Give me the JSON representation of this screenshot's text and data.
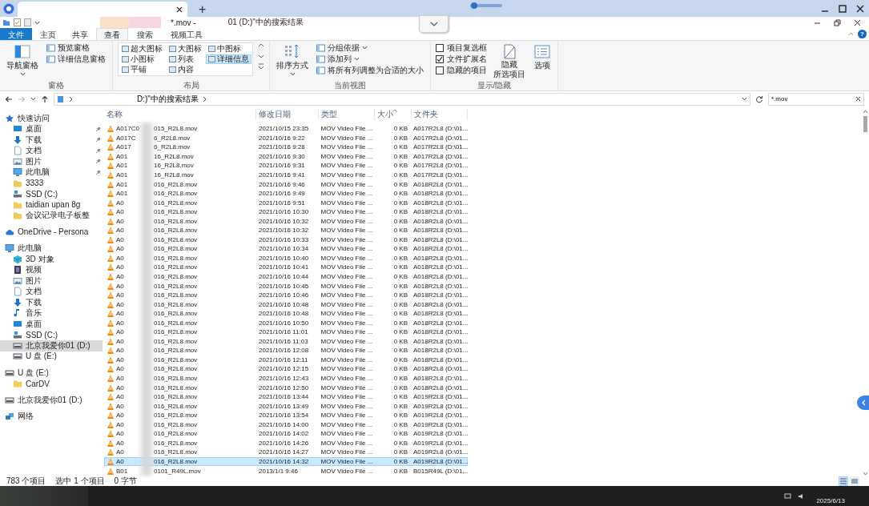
{
  "browser": {
    "new_tab": "+"
  },
  "window": {
    "title_start": "*.mov - ",
    "title_end": "01 (D:)\"中的搜索结果"
  },
  "ribbon": {
    "help": "?",
    "tabs": [
      {
        "label": "文件",
        "kind": "file",
        "selected": false
      },
      {
        "label": "主页",
        "kind": "normal",
        "selected": false
      },
      {
        "label": "共享",
        "kind": "normal",
        "selected": false
      },
      {
        "label": "查看",
        "kind": "normal",
        "selected": true
      },
      {
        "label": "搜索",
        "kind": "search",
        "selected": false
      },
      {
        "label": "视频工具",
        "kind": "video",
        "selected": false
      }
    ],
    "groups": [
      {
        "label": "窗格",
        "items": [
          {
            "kind": "large",
            "label": "导航窗格",
            "dropdown": true
          },
          {
            "kind": "small",
            "label": "预览窗格",
            "dropdown": false
          },
          {
            "kind": "small",
            "label": "详细信息窗格",
            "dropdown": false
          }
        ]
      },
      {
        "label": "布局",
        "items": [
          {
            "kind": "view",
            "label": "超大图标",
            "selected": false
          },
          {
            "kind": "view",
            "label": "大图标",
            "selected": false
          },
          {
            "kind": "view",
            "label": "中图标",
            "selected": false
          },
          {
            "kind": "view",
            "label": "小图标",
            "selected": false
          },
          {
            "kind": "view",
            "label": "列表",
            "selected": false
          },
          {
            "kind": "view",
            "label": "详细信息",
            "selected": true
          },
          {
            "kind": "view",
            "label": "平铺",
            "selected": false
          },
          {
            "kind": "view",
            "label": "内容",
            "selected": false
          }
        ]
      },
      {
        "label": "当前视图",
        "items": [
          {
            "kind": "large",
            "label": "排序方式",
            "dropdown": true
          },
          {
            "kind": "small",
            "label": "分组依据",
            "dropdown": true
          },
          {
            "kind": "small",
            "label": "添加列",
            "dropdown": true
          },
          {
            "kind": "small",
            "label": "将所有列调整为合适的大小",
            "dropdown": false
          }
        ]
      },
      {
        "label": "显示/隐藏",
        "items": [
          {
            "kind": "check",
            "label": "项目复选框",
            "checked": false
          },
          {
            "kind": "check",
            "label": "文件扩展名",
            "checked": true
          },
          {
            "kind": "check",
            "label": "隐藏的项目",
            "checked": false
          },
          {
            "kind": "large2",
            "lines": [
              "隐藏",
              "所选项目"
            ]
          },
          {
            "kind": "large",
            "label": "选项",
            "dropdown": false
          }
        ]
      }
    ]
  },
  "address": {
    "path_end": "D:)\"中的搜索结果",
    "search_value": "*.mov"
  },
  "nav": [
    {
      "label": "快速访问",
      "kind": "star",
      "selected": false,
      "children": [
        {
          "label": "桌面",
          "kind": "desktop",
          "selected": false,
          "pinned": true
        },
        {
          "label": "下载",
          "kind": "download",
          "selected": false,
          "pinned": true
        },
        {
          "label": "文档",
          "kind": "document",
          "selected": false,
          "pinned": true
        },
        {
          "label": "图片",
          "kind": "picture",
          "selected": false,
          "pinned": true
        },
        {
          "label": "此电脑",
          "kind": "computer",
          "selected": false,
          "pinned": true
        },
        {
          "label": "3333",
          "kind": "folder",
          "selected": false,
          "pinned": false
        },
        {
          "label": "SSD (C:)",
          "kind": "sysdrive",
          "selected": false,
          "pinned": false
        },
        {
          "label": "taidian upan 8g",
          "kind": "folder",
          "selected": false,
          "pinned": false
        },
        {
          "label": "会议记录电子板整",
          "kind": "folder",
          "selected": false,
          "pinned": false
        }
      ]
    },
    {
      "label": "OneDrive - Persona",
      "kind": "cloud",
      "selected": false
    },
    {
      "label": "此电脑",
      "kind": "computer",
      "selected": false,
      "children": [
        {
          "label": "3D 对象",
          "kind": "cube",
          "selected": false
        },
        {
          "label": "视频",
          "kind": "video",
          "selected": false
        },
        {
          "label": "图片",
          "kind": "picture",
          "selected": false
        },
        {
          "label": "文档",
          "kind": "document",
          "selected": false
        },
        {
          "label": "下载",
          "kind": "download",
          "selected": false
        },
        {
          "label": "音乐",
          "kind": "music",
          "selected": false
        },
        {
          "label": "桌面",
          "kind": "desktop",
          "selected": false
        },
        {
          "label": "SSD (C:)",
          "kind": "sysdrive",
          "selected": false
        },
        {
          "label": "北京我爱你01 (D:)",
          "kind": "drive",
          "selected": true
        },
        {
          "label": "U 盘 (E:)",
          "kind": "drive",
          "selected": false
        }
      ]
    },
    {
      "label": "U 盘 (E:)",
      "kind": "drive",
      "selected": false,
      "children": [
        {
          "label": "CarDV",
          "kind": "folder",
          "selected": false
        }
      ]
    },
    {
      "label": "北京我爱你01 (D:)",
      "kind": "drive",
      "selected": false
    },
    {
      "label": "网络",
      "kind": "network",
      "selected": false
    }
  ],
  "files": {
    "columns": [
      {
        "label": "名称",
        "sorted": false
      },
      {
        "label": "修改日期",
        "sorted": false
      },
      {
        "label": "类型",
        "sorted": false
      },
      {
        "label": "大小",
        "sorted": true
      },
      {
        "label": "文件夹",
        "sorted": false
      }
    ],
    "rows": [
      {
        "name_start": "A017C0",
        "name_end": "015_R2L8.mov",
        "modified": "2021/10/15 23:35",
        "type": "MOV Video File ...",
        "size": "0 KB",
        "folder": "A017R2L8 (D:\\01...",
        "selected": false
      },
      {
        "name_start": "A017C",
        "name_end": "6_R2L8.mov",
        "modified": "2021/10/16 9:22",
        "type": "MOV Video File ...",
        "size": "0 KB",
        "folder": "A017R2L8 (D:\\01...",
        "selected": false
      },
      {
        "name_start": "A017",
        "name_end": "6_R2L8.mov",
        "modified": "2021/10/16 9:28",
        "type": "MOV Video File ...",
        "size": "0 KB",
        "folder": "A017R2L8 (D:\\01...",
        "selected": false
      },
      {
        "name_start": "A01",
        "name_end": "16_R2L8.mov",
        "modified": "2021/10/16 9:30",
        "type": "MOV Video File ...",
        "size": "0 KB",
        "folder": "A017R2L8 (D:\\01...",
        "selected": false
      },
      {
        "name_start": "A01",
        "name_end": "16_R2L8.mov",
        "modified": "2021/10/16 9:31",
        "type": "MOV Video File ...",
        "size": "0 KB",
        "folder": "A017R2L8 (D:\\01...",
        "selected": false
      },
      {
        "name_start": "A01",
        "name_end": "16_R2L8.mov",
        "modified": "2021/10/16 9:41",
        "type": "MOV Video File ...",
        "size": "0 KB",
        "folder": "A017R2L8 (D:\\01...",
        "selected": false
      },
      {
        "name_start": "A01",
        "name_end": "016_R2L8.mov",
        "modified": "2021/10/16 9:46",
        "type": "MOV Video File ...",
        "size": "0 KB",
        "folder": "A018R2L8 (D:\\01...",
        "selected": false
      },
      {
        "name_start": "A01",
        "name_end": "016_R2L8.mov",
        "modified": "2021/10/16 9:49",
        "type": "MOV Video File ...",
        "size": "0 KB",
        "folder": "A018R2L8 (D:\\01...",
        "selected": false
      },
      {
        "name_start": "A0",
        "name_end": "016_R2L8.mov",
        "modified": "2021/10/16 9:51",
        "type": "MOV Video File ...",
        "size": "0 KB",
        "folder": "A018R2L8 (D:\\01...",
        "selected": false
      },
      {
        "name_start": "A0",
        "name_end": "016_R2L8.mov",
        "modified": "2021/10/16 10:30",
        "type": "MOV Video File ...",
        "size": "0 KB",
        "folder": "A018R2L8 (D:\\01...",
        "selected": false
      },
      {
        "name_start": "A0",
        "name_end": "016_R2L8.mov",
        "modified": "2021/10/16 10:32",
        "type": "MOV Video File ...",
        "size": "0 KB",
        "folder": "A018R2L8 (D:\\01...",
        "selected": false
      },
      {
        "name_start": "A0",
        "name_end": "016_R2L8.mov",
        "modified": "2021/10/16 10:32",
        "type": "MOV Video File ...",
        "size": "0 KB",
        "folder": "A018R2L8 (D:\\01...",
        "selected": false
      },
      {
        "name_start": "A0",
        "name_end": "016_R2L8.mov",
        "modified": "2021/10/16 10:33",
        "type": "MOV Video File ...",
        "size": "0 KB",
        "folder": "A018R2L8 (D:\\01...",
        "selected": false
      },
      {
        "name_start": "A0",
        "name_end": "016_R2L8.mov",
        "modified": "2021/10/16 10:34",
        "type": "MOV Video File ...",
        "size": "0 KB",
        "folder": "A018R2L8 (D:\\01...",
        "selected": false
      },
      {
        "name_start": "A0",
        "name_end": "016_R2L8.mov",
        "modified": "2021/10/16 10:40",
        "type": "MOV Video File ...",
        "size": "0 KB",
        "folder": "A018R2L8 (D:\\01...",
        "selected": false
      },
      {
        "name_start": "A0",
        "name_end": "016_R2L8.mov",
        "modified": "2021/10/16 10:41",
        "type": "MOV Video File ...",
        "size": "0 KB",
        "folder": "A018R2L8 (D:\\01...",
        "selected": false
      },
      {
        "name_start": "A0",
        "name_end": "016_R2L8.mov",
        "modified": "2021/10/16 10:44",
        "type": "MOV Video File ...",
        "size": "0 KB",
        "folder": "A018R2L8 (D:\\01...",
        "selected": false
      },
      {
        "name_start": "A0",
        "name_end": "016_R2L8.mov",
        "modified": "2021/10/16 10:45",
        "type": "MOV Video File ...",
        "size": "0 KB",
        "folder": "A018R2L8 (D:\\01...",
        "selected": false
      },
      {
        "name_start": "A0",
        "name_end": "016_R2L8.mov",
        "modified": "2021/10/16 10:46",
        "type": "MOV Video File ...",
        "size": "0 KB",
        "folder": "A018R2L8 (D:\\01...",
        "selected": false
      },
      {
        "name_start": "A0",
        "name_end": "016_R2L8.mov",
        "modified": "2021/10/16 10:48",
        "type": "MOV Video File ...",
        "size": "0 KB",
        "folder": "A018R2L8 (D:\\01...",
        "selected": false
      },
      {
        "name_start": "A0",
        "name_end": "016_R2L8.mov",
        "modified": "2021/10/16 10:48",
        "type": "MOV Video File ...",
        "size": "0 KB",
        "folder": "A018R2L8 (D:\\01...",
        "selected": false
      },
      {
        "name_start": "A0",
        "name_end": "016_R2L8.mov",
        "modified": "2021/10/16 10:50",
        "type": "MOV Video File ...",
        "size": "0 KB",
        "folder": "A018R2L8 (D:\\01...",
        "selected": false
      },
      {
        "name_start": "A0",
        "name_end": "016_R2L8.mov",
        "modified": "2021/10/16 11:01",
        "type": "MOV Video File ...",
        "size": "0 KB",
        "folder": "A018R2L8 (D:\\01...",
        "selected": false
      },
      {
        "name_start": "A0",
        "name_end": "016_R2L8.mov",
        "modified": "2021/10/16 11:03",
        "type": "MOV Video File ...",
        "size": "0 KB",
        "folder": "A018R2L8 (D:\\01...",
        "selected": false
      },
      {
        "name_start": "A0",
        "name_end": "016_R2L8.mov",
        "modified": "2021/10/16 12:08",
        "type": "MOV Video File ...",
        "size": "0 KB",
        "folder": "A018R2L8 (D:\\01...",
        "selected": false
      },
      {
        "name_start": "A0",
        "name_end": "016_R2L8.mov",
        "modified": "2021/10/16 12:11",
        "type": "MOV Video File ...",
        "size": "0 KB",
        "folder": "A018R2L8 (D:\\01...",
        "selected": false
      },
      {
        "name_start": "A0",
        "name_end": "016_R2L8.mov",
        "modified": "2021/10/16 12:15",
        "type": "MOV Video File ...",
        "size": "0 KB",
        "folder": "A018R2L8 (D:\\01...",
        "selected": false
      },
      {
        "name_start": "A0",
        "name_end": "016_R2L8.mov",
        "modified": "2021/10/16 12:43",
        "type": "MOV Video File ...",
        "size": "0 KB",
        "folder": "A018R2L8 (D:\\01...",
        "selected": false
      },
      {
        "name_start": "A0",
        "name_end": "016_R2L8.mov",
        "modified": "2021/10/16 12:50",
        "type": "MOV Video File ...",
        "size": "0 KB",
        "folder": "A018R2L8 (D:\\01...",
        "selected": false
      },
      {
        "name_start": "A0",
        "name_end": "016_R2L8.mov",
        "modified": "2021/10/16 13:44",
        "type": "MOV Video File ...",
        "size": "0 KB",
        "folder": "A019R2L8 (D:\\01...",
        "selected": false
      },
      {
        "name_start": "A0",
        "name_end": "016_R2L8.mov",
        "modified": "2021/10/16 13:49",
        "type": "MOV Video File ...",
        "size": "0 KB",
        "folder": "A019R2L8 (D:\\01...",
        "selected": false
      },
      {
        "name_start": "A0",
        "name_end": "016_R2L8.mov",
        "modified": "2021/10/16 13:54",
        "type": "MOV Video File ...",
        "size": "0 KB",
        "folder": "A019R2L8 (D:\\01...",
        "selected": false
      },
      {
        "name_start": "A0",
        "name_end": "016_R2L8.mov",
        "modified": "2021/10/16 14:00",
        "type": "MOV Video File ...",
        "size": "0 KB",
        "folder": "A019R2L8 (D:\\01...",
        "selected": false
      },
      {
        "name_start": "A0",
        "name_end": "016_R2L8.mov",
        "modified": "2021/10/16 14:02",
        "type": "MOV Video File ...",
        "size": "0 KB",
        "folder": "A019R2L8 (D:\\01...",
        "selected": false
      },
      {
        "name_start": "A0",
        "name_end": "016_R2L8.mov",
        "modified": "2021/10/16 14:26",
        "type": "MOV Video File ...",
        "size": "0 KB",
        "folder": "A019R2L8 (D:\\01...",
        "selected": false
      },
      {
        "name_start": "A0",
        "name_end": "016_R2L8.mov",
        "modified": "2021/10/16 14:27",
        "type": "MOV Video File ...",
        "size": "0 KB",
        "folder": "A019R2L8 (D:\\01...",
        "selected": false
      },
      {
        "name_start": "A0",
        "name_end": "016_R2L8.mov",
        "modified": "2021/10/16 14:32",
        "type": "MOV Video File ...",
        "size": "0 KB",
        "folder": "A019R2L8 (D:\\01...",
        "selected": true
      },
      {
        "name_start": "B01",
        "name_end": "0101_R49L.mov",
        "modified": "2013/1/1 9:46",
        "type": "MOV Video File ...",
        "size": "0 KB",
        "folder": "B015R49L (D:\\01...",
        "selected": false
      }
    ]
  },
  "status": {
    "count": "783 个项目",
    "selection": "选中 1 个项目",
    "size": "0 字节",
    "views": [
      {
        "kind": "details",
        "selected": true
      },
      {
        "kind": "thumbnails",
        "selected": false
      }
    ]
  },
  "taskbar": {
    "date": "2025/6/13"
  }
}
